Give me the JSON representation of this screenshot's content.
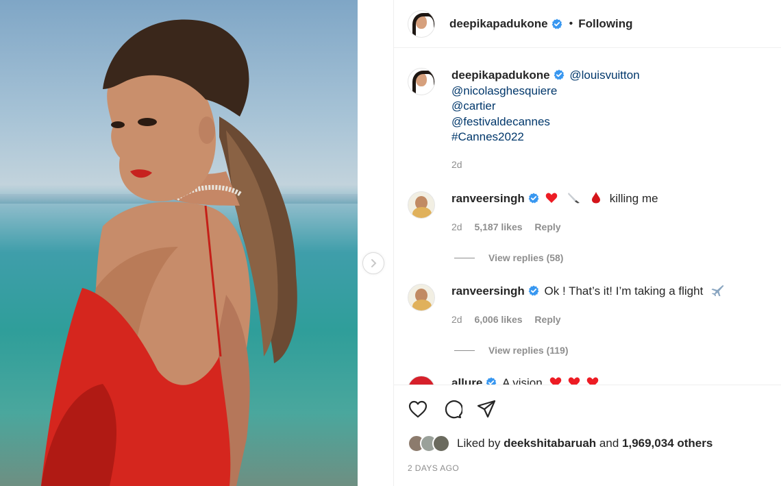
{
  "post": {
    "author": "deepikapadukone",
    "follow_status": "Following",
    "separator": "•"
  },
  "caption": {
    "username": "deepikapadukone",
    "lines": [
      "@louisvuitton",
      "@nicolasghesquiere",
      "@cartier",
      "@festivaldecannes",
      "#Cannes2022"
    ],
    "age": "2d"
  },
  "comments": [
    {
      "username": "ranveersingh",
      "text": "killing me",
      "emojis": [
        "heart-emoji",
        "knife-emoji",
        "drop-of-blood-emoji"
      ],
      "age": "2d",
      "likes": "5,187 likes",
      "reply_label": "Reply",
      "view_replies": "View replies (58)"
    },
    {
      "username": "ranveersingh",
      "text": "Ok ! That’s it! I’m taking a flight",
      "emojis": [
        "airplane-emoji"
      ],
      "age": "2d",
      "likes": "6,006 likes",
      "reply_label": "Reply",
      "view_replies": "View replies (119)"
    },
    {
      "username": "allure",
      "text": "A vision",
      "emojis": [
        "heart-emoji",
        "heart-emoji",
        "heart-emoji"
      ]
    }
  ],
  "likes": {
    "prefix": "Liked by",
    "user": "deekshitabaruah",
    "conjunction": "and",
    "count": "1,969,034 others"
  },
  "timestamp": "2 DAYS AGO",
  "icons": [
    "verified-badge-icon",
    "chevron-right-icon",
    "heart-icon",
    "comment-icon",
    "share-icon"
  ],
  "colors": {
    "link": "#00376b",
    "verified": "#3897f0",
    "muted": "#8e8e8e",
    "heart": "#ed1c24"
  }
}
